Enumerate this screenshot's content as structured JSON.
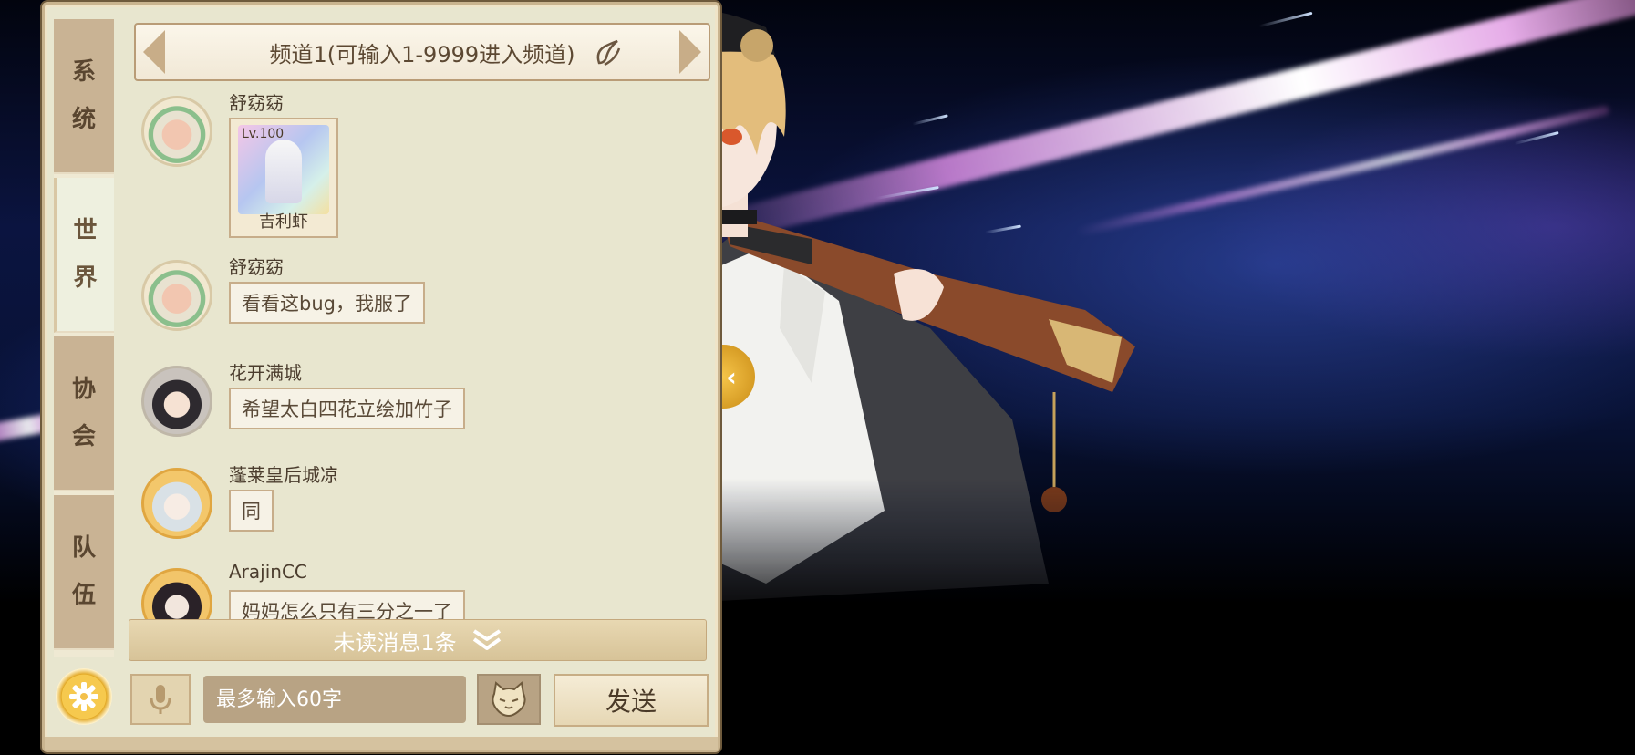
{
  "tabs": [
    {
      "label_top": "系",
      "label_bottom": "统",
      "active": false
    },
    {
      "label_top": "世",
      "label_bottom": "界",
      "active": true
    },
    {
      "label_top": "协",
      "label_bottom": "会",
      "active": false
    },
    {
      "label_top": "队",
      "label_bottom": "伍",
      "active": false
    }
  ],
  "header": {
    "channel_text": "频道1(可输入1-9999进入频道)",
    "switch_icon": "channel-switch-icon"
  },
  "messages": [
    {
      "name": "舒窈窈",
      "type": "card",
      "card": {
        "level": "Lv.100",
        "name": "吉利虾"
      }
    },
    {
      "name": "舒窈窈",
      "type": "text",
      "text": "看看这bug，我服了"
    },
    {
      "name": "花开满城",
      "type": "text",
      "text": "希望太白四花立绘加竹子"
    },
    {
      "name": "蓬莱皇后城凉",
      "type": "text",
      "text": "同"
    },
    {
      "name": "ArajinCC",
      "type": "text",
      "text": "妈妈怎么只有三分之一了"
    }
  ],
  "unread": {
    "label": "未读消息1条",
    "icon": "chevron-double-down-icon"
  },
  "input": {
    "placeholder": "最多输入60字",
    "value": ""
  },
  "buttons": {
    "send": "发送",
    "voice_icon": "microphone-icon",
    "emoji_icon": "cat-emoji-icon",
    "settings_icon": "gear-icon"
  },
  "colors": {
    "panel_bg": "#e8e6cf",
    "tab_bg": "#c9b394",
    "accent_gold": "#f6c94e",
    "text_brown": "#5a4630"
  }
}
